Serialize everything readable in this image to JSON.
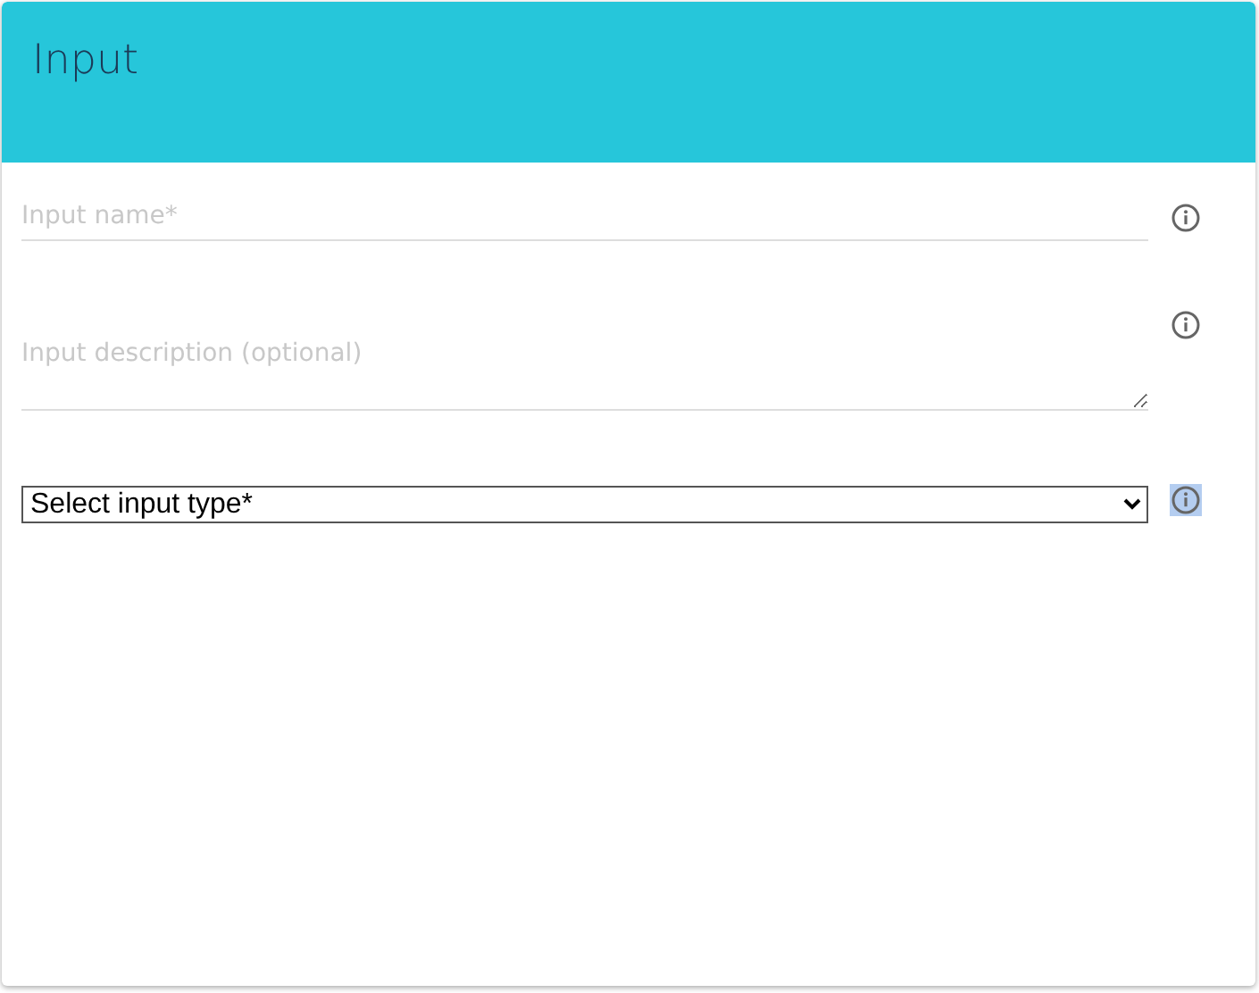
{
  "header": {
    "title": "Input"
  },
  "fields": [
    {
      "kind": "text",
      "placeholder": "Input name*",
      "info_highlighted": false
    },
    {
      "kind": "textarea",
      "placeholder": "Input description (optional)",
      "info_highlighted": false
    },
    {
      "kind": "select",
      "value": "Select input type*",
      "info_highlighted": true
    }
  ]
}
